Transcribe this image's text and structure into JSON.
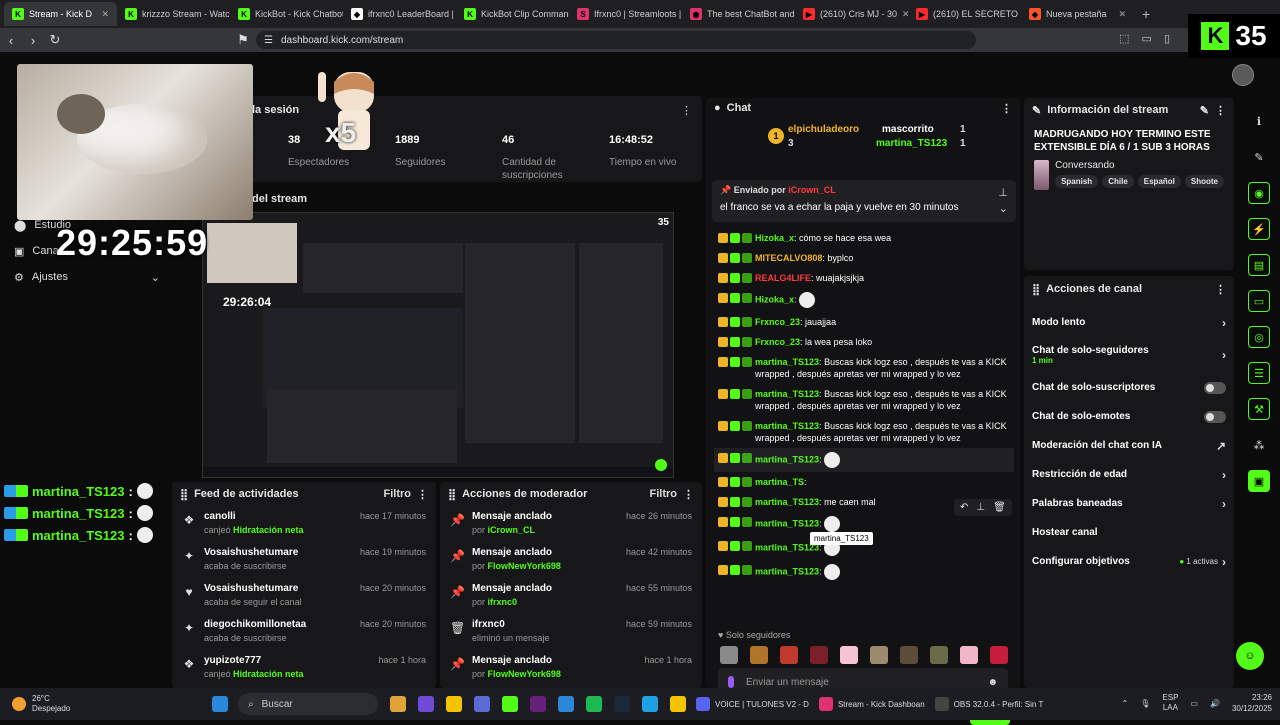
{
  "browser": {
    "tabs": [
      {
        "label": "Stream - Kick D",
        "color": "#53fc18",
        "glyph": "K"
      },
      {
        "label": "krizzzo Stream - Watc",
        "color": "#53fc18",
        "glyph": "K"
      },
      {
        "label": "KickBot - Kick Chatbot",
        "color": "#53fc18",
        "glyph": "K"
      },
      {
        "label": "ifrxnc0 LeaderBoard |",
        "color": "#ffffff",
        "glyph": "◆"
      },
      {
        "label": "KickBot Clip Command",
        "color": "#53fc18",
        "glyph": "K"
      },
      {
        "label": "Ifrxnc0 | Streamloots |",
        "color": "#e0336e",
        "glyph": "S"
      },
      {
        "label": "The best ChatBot and",
        "color": "#e0336e",
        "glyph": "◉"
      },
      {
        "label": "(2610) Cris MJ - 30",
        "color": "#ff2b2b",
        "glyph": "▶"
      },
      {
        "label": "(2610) EL SECRETO FIN",
        "color": "#ff2b2b",
        "glyph": "▶"
      },
      {
        "label": "Nueva pestaña",
        "color": "#fb542b",
        "glyph": "◆"
      }
    ],
    "url": "dashboard.kick.com/stream",
    "badge_count": "35"
  },
  "session": {
    "title": "la sesión",
    "stats": [
      {
        "value": "38",
        "label": "Espectadores"
      },
      {
        "value": "1889",
        "label": "Seguidores"
      },
      {
        "value": "46",
        "label": "Cantidad de suscripciones"
      },
      {
        "value": "16:48:52",
        "label": "Tiempo en vivo"
      }
    ]
  },
  "overlay": {
    "clock": "29:25:59",
    "x5": "x5",
    "mini_clock": "29:26:04",
    "mini_badge": "35",
    "menu": [
      {
        "icon": "⬤",
        "label": "Estudio"
      },
      {
        "icon": "▣",
        "label": "Cana"
      },
      {
        "icon": "⚙",
        "label": "Ajustes"
      }
    ],
    "chat_lines": [
      "martina_TS123",
      "martina_TS123",
      "martina_TS123"
    ]
  },
  "stream_preview": {
    "title": "del stream"
  },
  "feed": {
    "title": "Feed de actividades",
    "filter": "Filtro",
    "items": [
      {
        "icon": "❖",
        "name": "canolli",
        "sub_prefix": "canjeó ",
        "sub_hl": "Hidratación neta",
        "time": "hace 17 minutos"
      },
      {
        "icon": "✦",
        "name": "Vosaishushetumare",
        "sub_prefix": "acaba de suscribirse",
        "sub_hl": "",
        "time": "hace 19 minutos"
      },
      {
        "icon": "♥",
        "name": "Vosaishushetumare",
        "sub_prefix": "acaba de seguir el canal",
        "sub_hl": "",
        "time": "hace 20 minutos"
      },
      {
        "icon": "✦",
        "name": "diegochikomillonetaa",
        "sub_prefix": "acaba de suscribirse",
        "sub_hl": "",
        "time": "hace 20 minutos"
      },
      {
        "icon": "❖",
        "name": "yupizote777",
        "sub_prefix": "canjeó ",
        "sub_hl": "Hidratación neta",
        "time": "hace 1 hora"
      }
    ]
  },
  "modactions": {
    "title": "Acciones de moderador",
    "filter": "Filtro",
    "items": [
      {
        "icon": "📌",
        "name": "Mensaje anclado",
        "sub_prefix": "por ",
        "sub_hl": "iCrown_CL",
        "time": "hace 26 minutos"
      },
      {
        "icon": "📌",
        "name": "Mensaje anclado",
        "sub_prefix": "por ",
        "sub_hl": "FlowNewYork698",
        "time": "hace 42 minutos"
      },
      {
        "icon": "📌",
        "name": "Mensaje anclado",
        "sub_prefix": "por ",
        "sub_hl": "ifrxnc0",
        "time": "hace 55 minutos"
      },
      {
        "icon": "🗑",
        "name": "ifrxnc0",
        "sub_prefix": "eliminó un mensaje",
        "sub_hl": "",
        "time": "hace 59 minutos"
      },
      {
        "icon": "📌",
        "name": "Mensaje anclado",
        "sub_prefix": "por ",
        "sub_hl": "FlowNewYork698",
        "time": "hace 1 hora"
      }
    ]
  },
  "chat": {
    "title": "Chat",
    "leaders": [
      {
        "name": "elpichuladeoro",
        "count": "3",
        "color": "#f0b429"
      },
      {
        "name": "mascorrito",
        "count": "1",
        "color": "#ffffff"
      },
      {
        "name": "martina_TS123",
        "count": "1",
        "color": "#53fc18"
      }
    ],
    "pinned": {
      "header": "Enviado por",
      "by": "iCrown_CL",
      "message": "el franco se va a echar la paja y vuelve en 30 minutos"
    },
    "messages": [
      {
        "user": "Hizoka_x",
        "color": "#53fc18",
        "text": "cómo se hace esa wea",
        "emote": false
      },
      {
        "user": "MITECALVO808",
        "color": "#f0b429",
        "text": "byplco",
        "emote": false
      },
      {
        "user": "REALG4LIFE",
        "color": "#ff3b3b",
        "text": "wuajakjsjkja",
        "emote": false
      },
      {
        "user": "Hizoka_x",
        "color": "#53fc18",
        "text": "",
        "emote": true
      },
      {
        "user": "Frxnco_23",
        "color": "#53fc18",
        "text": "jauajjaa",
        "emote": false
      },
      {
        "user": "Frxnco_23",
        "color": "#53fc18",
        "text": "la wea pesa loko",
        "emote": false
      },
      {
        "user": "martina_TS123",
        "color": "#53fc18",
        "text": "Buscas kick logz eso , después te vas a KICK wrapped , después apretas ver mi wrapped y lo vez",
        "emote": false
      },
      {
        "user": "martina_TS123",
        "color": "#53fc18",
        "text": "Buscas kick logz eso , después te vas a KICK wrapped , después apretas ver mi wrapped y lo vez",
        "emote": false
      },
      {
        "user": "martina_TS123",
        "color": "#53fc18",
        "text": "Buscas kick logz eso , después te vas a KICK wrapped , después apretas ver mi wrapped y lo vez",
        "emote": false
      },
      {
        "user": "martina_TS123",
        "color": "#53fc18",
        "text": "",
        "emote": true
      },
      {
        "user": "martina_TS",
        "color": "#53fc18",
        "text": "",
        "emote": false
      },
      {
        "user": "martina_TS123",
        "color": "#53fc18",
        "text": "me caen mal",
        "emote": false
      },
      {
        "user": "martina_TS123",
        "color": "#53fc18",
        "text": "",
        "emote": true
      },
      {
        "user": "martina_TS123",
        "color": "#53fc18",
        "text": "",
        "emote": true
      },
      {
        "user": "martina_TS123",
        "color": "#53fc18",
        "text": "",
        "emote": true
      }
    ],
    "tooltip": "martina_TS123",
    "followers_only": "Solo seguidores",
    "input_placeholder": "Enviar un mensaje",
    "footer_count": "0",
    "send_label": "Chat"
  },
  "stream_info": {
    "title": "Información del stream",
    "stream_title": "MADRUGANDO HOY TERMINO ESTE EXTENSIBLE DÍA 6 / 1 SUB 3 HORAS",
    "category": "Conversando",
    "tags": [
      "Spanish",
      "Chile",
      "Español",
      "Shoote"
    ]
  },
  "channel_actions": {
    "title": "Acciones de canal",
    "items": [
      {
        "label": "Modo lento",
        "sub": "",
        "control": "chevron"
      },
      {
        "label": "Chat de solo-seguidores",
        "sub": "1 min",
        "control": "chevron"
      },
      {
        "label": "Chat de solo-suscriptores",
        "sub": "",
        "control": "toggle"
      },
      {
        "label": "Chat de solo-emotes",
        "sub": "",
        "control": "toggle"
      },
      {
        "label": "Moderación del chat con IA",
        "sub": "",
        "control": "external"
      },
      {
        "label": "Restricción de edad",
        "sub": "",
        "control": "chevron"
      },
      {
        "label": "Palabras baneadas",
        "sub": "",
        "control": "chevron"
      },
      {
        "label": "Hostear canal",
        "sub": "",
        "control": "none"
      },
      {
        "label": "Configurar objetivos",
        "sub": "",
        "control": "goals"
      }
    ],
    "goals_active": "1 activas"
  },
  "taskbar": {
    "temp": "26°C",
    "weather": "Despejado",
    "search": "Buscar",
    "apps": [
      {
        "label": "VOICE | TULONES V2 - D",
        "color": "#5865f2"
      },
      {
        "label": "Stream - Kick Dashboan",
        "color": "#e0336e"
      },
      {
        "label": "OBS 32.0.4 - Perfil: Sin T",
        "color": "#444444"
      }
    ],
    "lang": "ESP",
    "lang2": "LAA",
    "time": "23:26",
    "date": "30/12/2025"
  },
  "colors": {
    "accent": "#53fc18",
    "panel": "#17171a",
    "bg": "#0b0b0c"
  }
}
